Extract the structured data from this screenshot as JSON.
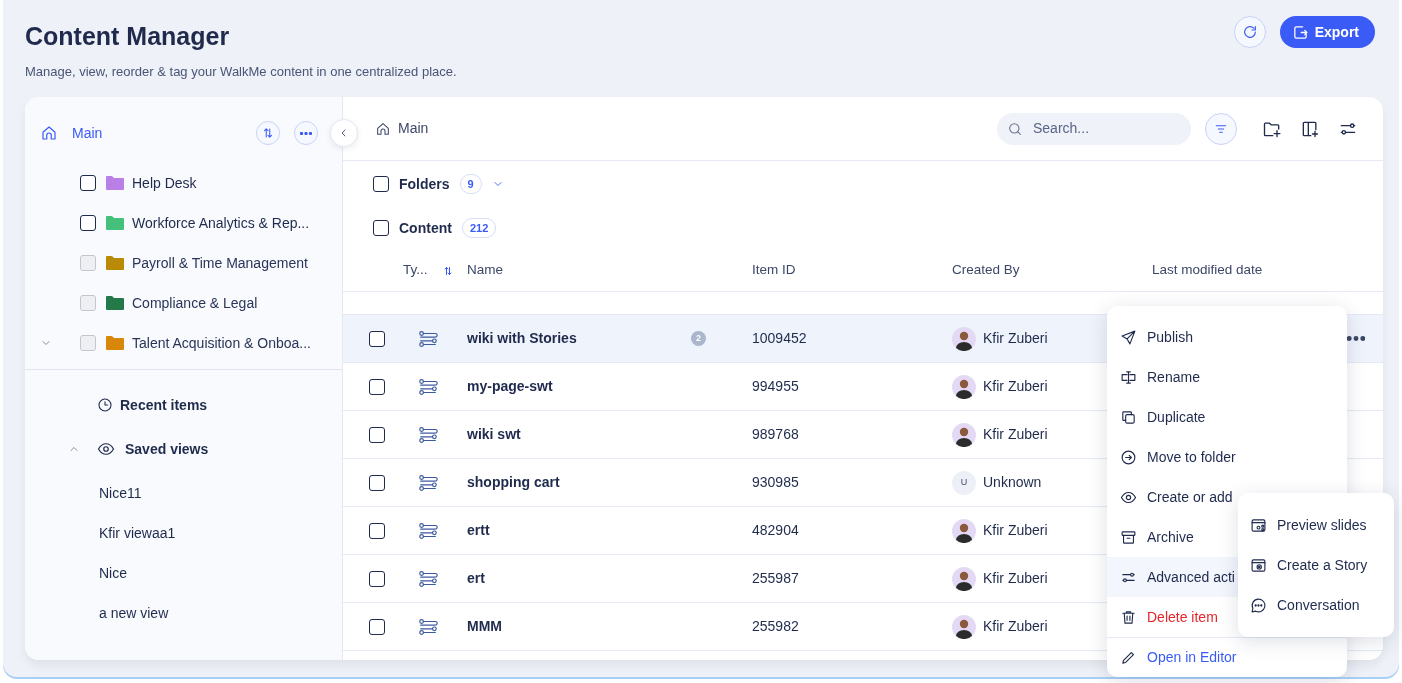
{
  "header": {
    "title": "Content Manager",
    "subtitle": "Manage, view, reorder & tag your WalkMe content in one centralized place.",
    "export_label": "Export"
  },
  "sidebar": {
    "root": {
      "label": "Main",
      "selected": true
    },
    "tree": [
      {
        "label": "Help Desk",
        "color": "#b97fe6",
        "checked": false,
        "disabled": false,
        "has_children": false
      },
      {
        "label": "Workforce Analytics & Rep...",
        "color": "#45c07a",
        "checked": false,
        "disabled": false,
        "has_children": false
      },
      {
        "label": "Payroll & Time Management",
        "color": "#b98a05",
        "checked": false,
        "disabled": true,
        "has_children": false
      },
      {
        "label": "Compliance & Legal",
        "color": "#237a48",
        "checked": false,
        "disabled": true,
        "has_children": false
      },
      {
        "label": "Talent Acquisition & Onboa...",
        "color": "#d8870a",
        "checked": false,
        "disabled": true,
        "has_children": true
      }
    ],
    "recent_label": "Recent items",
    "saved_views": {
      "label": "Saved views",
      "expanded": true,
      "items": [
        "Nice11",
        "Kfir viewaa1",
        "Nice",
        "a new view"
      ]
    }
  },
  "toolbar": {
    "breadcrumb": "Main",
    "search_placeholder": "Search..."
  },
  "groups": [
    {
      "label": "Folders",
      "count": "9",
      "checked": false,
      "collapsible": true
    },
    {
      "label": "Content",
      "count": "212",
      "checked": false,
      "collapsible": false
    }
  ],
  "table": {
    "columns": [
      "Ty...",
      "Name",
      "Item ID",
      "Created By",
      "Last modified date"
    ],
    "rows": [
      {
        "name": "wiki with Stories",
        "comments": "2",
        "item_id": "1009452",
        "created_by": "Kfir Zuberi",
        "hovered": true,
        "checked": false
      },
      {
        "name": "my-page-swt",
        "item_id": "994955",
        "created_by": "Kfir Zuberi",
        "hovered": false,
        "checked": false
      },
      {
        "name": "wiki swt",
        "item_id": "989768",
        "created_by": "Kfir Zuberi",
        "hovered": false,
        "checked": false
      },
      {
        "name": "shopping cart",
        "item_id": "930985",
        "created_by": "Unknown",
        "initial": "U",
        "hovered": false,
        "checked": false
      },
      {
        "name": "ertt",
        "item_id": "482904",
        "created_by": "Kfir Zuberi",
        "hovered": false,
        "checked": false
      },
      {
        "name": "ert",
        "item_id": "255987",
        "created_by": "Kfir Zuberi",
        "hovered": false,
        "checked": false
      },
      {
        "name": "MMM",
        "item_id": "255982",
        "created_by": "Kfir Zuberi",
        "hovered": false,
        "checked": false
      }
    ]
  },
  "context_menu": {
    "items": [
      {
        "label": "Publish",
        "kind": "normal",
        "highlighted": false
      },
      {
        "label": "Rename",
        "kind": "normal",
        "highlighted": false
      },
      {
        "label": "Duplicate",
        "kind": "normal",
        "highlighted": false
      },
      {
        "label": "Move to folder",
        "kind": "normal",
        "highlighted": false
      },
      {
        "label": "Create or add",
        "kind": "normal",
        "highlighted": false
      },
      {
        "label": "Archive",
        "kind": "normal",
        "highlighted": false
      },
      {
        "label": "Advanced acti",
        "kind": "normal",
        "highlighted": true
      },
      {
        "label": "Delete item",
        "kind": "danger",
        "highlighted": false
      },
      {
        "label": "Open in Editor",
        "kind": "link",
        "highlighted": false
      }
    ]
  },
  "submenu": {
    "items": [
      "Preview slides",
      "Create a Story",
      "Conversation"
    ]
  }
}
